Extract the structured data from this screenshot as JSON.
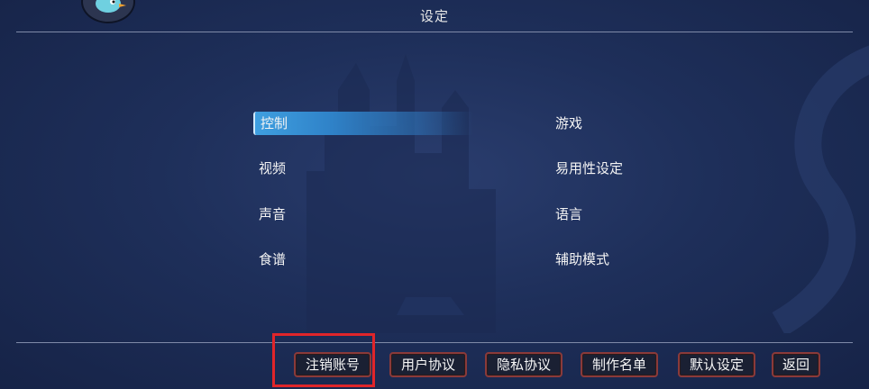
{
  "header": {
    "title": "设定"
  },
  "menu": {
    "left": [
      "控制",
      "视频",
      "声音",
      "食谱"
    ],
    "right": [
      "游戏",
      "易用性设定",
      "语言",
      "辅助模式"
    ],
    "selected": "控制"
  },
  "footer_buttons": [
    "注销账号",
    "用户协议",
    "隐私协议",
    "制作名单",
    "默认设定",
    "返回"
  ],
  "colors": {
    "highlight": "#e0252a",
    "selection": "#3f9fe0",
    "button_border": "#8a3a3a"
  }
}
